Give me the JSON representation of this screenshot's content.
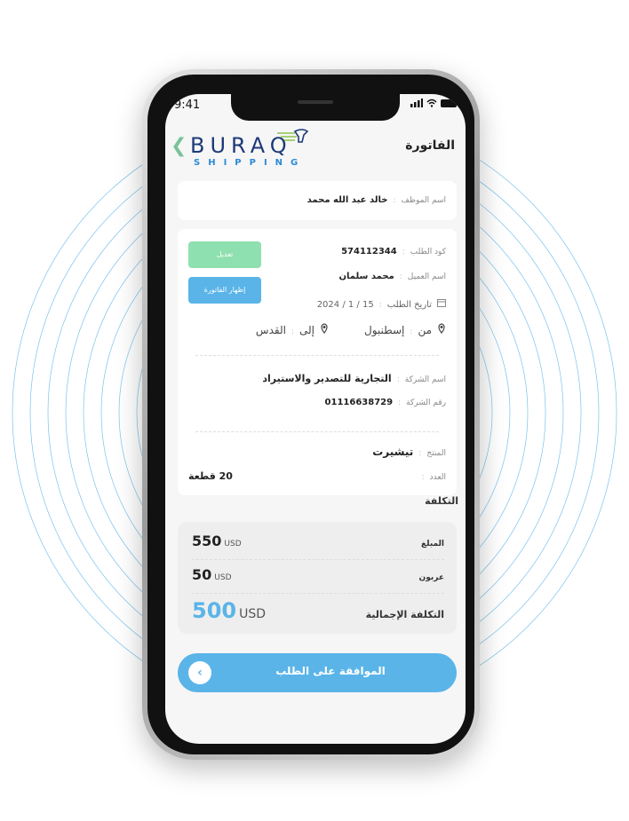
{
  "status": {
    "time": "9:41"
  },
  "header": {
    "logo_text": "BURAQ",
    "logo_subtext": "SHIPPING",
    "title": "الفاتورة"
  },
  "employee": {
    "label": "اسم الموظف",
    "value": "خالد عبد الله محمد"
  },
  "order": {
    "code_label": "كود الطلب",
    "code_value": "574112344",
    "client_label": "اسم العميل",
    "client_value": "محمد سلمان",
    "date_label": "تاريخ الطلب",
    "date_value": "15 / 1 / 2024",
    "from_label": "من",
    "from_value": "إسطنبول",
    "to_label": "إلى",
    "to_value": "القدس",
    "edit_button": "تعديل",
    "show_invoice_button": "إظهار الفاتورة"
  },
  "company": {
    "name_label": "اسم الشركة",
    "name_value": "التجارية للتصدير والاستيراد",
    "number_label": "رقم الشركة",
    "number_value": "01116638729"
  },
  "product": {
    "product_label": "المنتج",
    "product_value": "تيشيرت",
    "count_label": "العدد",
    "count_value": "20 قطعة"
  },
  "cost": {
    "section_title": "التكلفة",
    "amount_label": "المبلغ",
    "amount_value": "550",
    "amount_currency": "USD",
    "deposit_label": "عربون",
    "deposit_value": "50",
    "deposit_currency": "USD",
    "total_label": "التكلفة الإجمالية",
    "total_value": "500",
    "total_currency": "USD"
  },
  "approve_button": "الموافقة على الطلب",
  "colors": {
    "accent_blue": "#5ab4e8",
    "accent_green": "#8fe0b0",
    "logo_navy": "#1d3a78",
    "back_arrow": "#7ac29a"
  },
  "icons": [
    "back-chevron-icon",
    "calendar-icon",
    "location-pin-icon",
    "signal-icon",
    "wifi-icon",
    "battery-icon",
    "chevron-left-icon"
  ]
}
